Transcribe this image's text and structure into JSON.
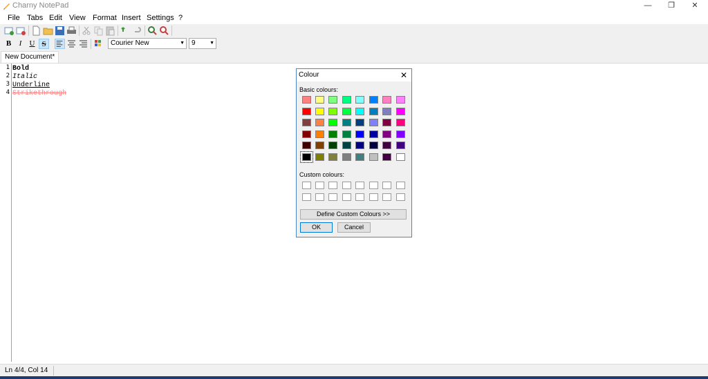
{
  "window": {
    "title": "Charny NotePad",
    "controls": [
      "—",
      "❐",
      "✕"
    ]
  },
  "menu": [
    "File",
    "Tabs",
    "Edit",
    "View",
    "Format",
    "Insert",
    "Settings",
    "?"
  ],
  "toolbar": {
    "icons": [
      "new-tab-icon",
      "close-tab-icon",
      "new-file-icon",
      "open-folder-icon",
      "save-icon",
      "print-icon",
      "cut-icon",
      "copy-icon",
      "paste-icon",
      "undo-icon",
      "redo-icon",
      "find-icon",
      "replace-icon"
    ]
  },
  "format_bar": {
    "bold": "B",
    "italic": "I",
    "underline": "U",
    "strike": "S",
    "font": "Courier New",
    "size": "9"
  },
  "tabs": [
    {
      "label": "New Document*"
    }
  ],
  "editor": {
    "lines": [
      {
        "num": "1",
        "text": "Bold",
        "style": "bold"
      },
      {
        "num": "2",
        "text": "Italic",
        "style": "italic"
      },
      {
        "num": "3",
        "text": "Underline",
        "style": "underline"
      },
      {
        "num": "4",
        "text": "Strikethrough",
        "style": "strikethrough"
      }
    ],
    "strike_color": "#ff8080"
  },
  "status": {
    "text": "Ln 4/4,    Col 14"
  },
  "dialog": {
    "title": "Colour",
    "basic_label": "Basic colours:",
    "custom_label": "Custom colours:",
    "define_button": "Define Custom Colours >>",
    "ok_button": "OK",
    "cancel_button": "Cancel",
    "basic_colours": [
      [
        "#ff8080",
        "#ffff80",
        "#80ff80",
        "#00ff80",
        "#80ffff",
        "#0080ff",
        "#ff80c0",
        "#ff80ff"
      ],
      [
        "#ff0000",
        "#ffff00",
        "#80ff00",
        "#00ff40",
        "#00ffff",
        "#0080c0",
        "#8080c0",
        "#ff00ff"
      ],
      [
        "#804040",
        "#ff8040",
        "#00ff00",
        "#008080",
        "#004080",
        "#8080ff",
        "#800040",
        "#ff0080"
      ],
      [
        "#800000",
        "#ff8000",
        "#008000",
        "#008040",
        "#0000ff",
        "#0000a0",
        "#800080",
        "#8000ff"
      ],
      [
        "#400000",
        "#804000",
        "#004000",
        "#004040",
        "#000080",
        "#000040",
        "#400040",
        "#400080"
      ],
      [
        "#000000",
        "#808000",
        "#808040",
        "#808080",
        "#408080",
        "#c0c0c0",
        "#400040",
        "#ffffff"
      ]
    ],
    "selected_colour": "#000000",
    "custom_colours": [
      [
        "#ffffff",
        "#ffffff",
        "#ffffff",
        "#ffffff",
        "#ffffff",
        "#ffffff",
        "#ffffff",
        "#ffffff"
      ],
      [
        "#ffffff",
        "#ffffff",
        "#ffffff",
        "#ffffff",
        "#ffffff",
        "#ffffff",
        "#ffffff",
        "#ffffff"
      ]
    ]
  }
}
